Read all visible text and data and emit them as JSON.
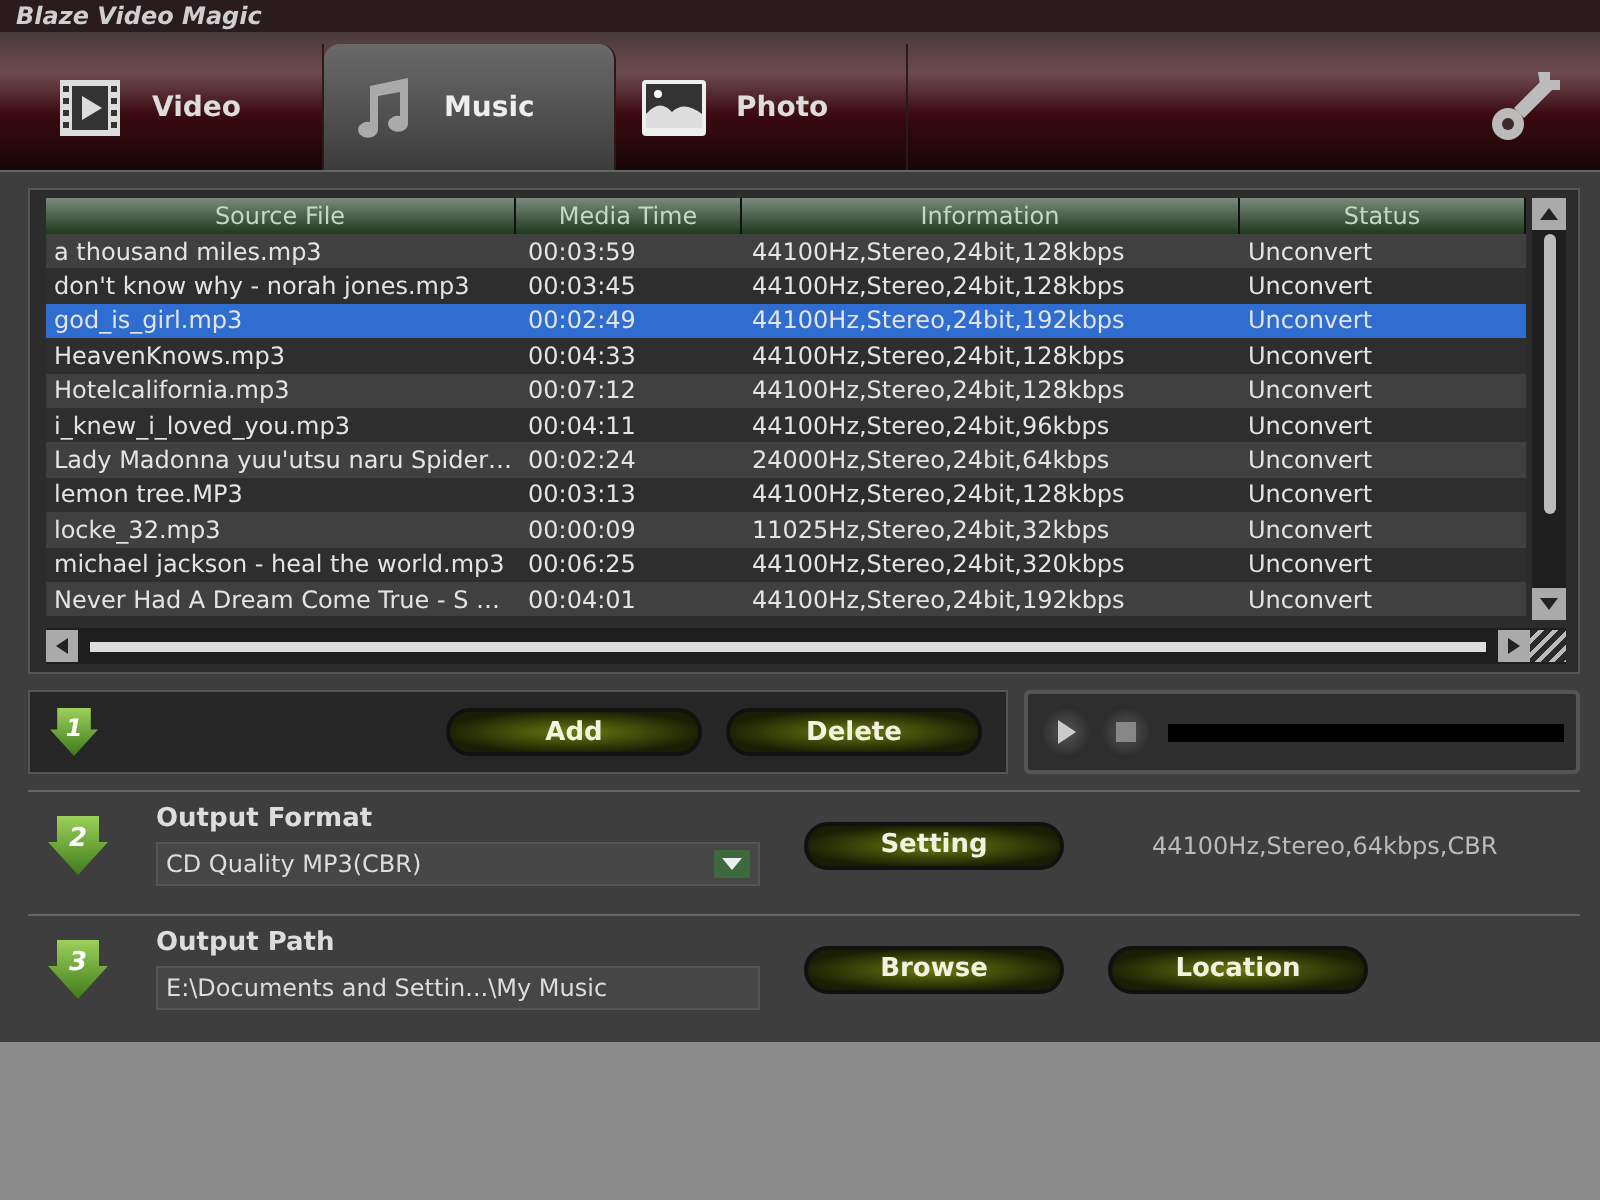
{
  "window": {
    "title": "Blaze Video Magic"
  },
  "player": {
    "level": 0
  },
  "tabs": [
    {
      "label": "Video",
      "kind": "video",
      "selected": false
    },
    {
      "label": "Music",
      "kind": "music",
      "selected": true
    },
    {
      "label": "Photo",
      "kind": "photo",
      "selected": false
    }
  ],
  "table": {
    "columns": [
      "Source File",
      "Media Time",
      "Information",
      "Status"
    ],
    "rows": [
      {
        "cells": [
          "a thousand miles.mp3",
          "00:03:59",
          "44100Hz,Stereo,24bit,128kbps",
          "Unconvert"
        ],
        "selected": false
      },
      {
        "cells": [
          "don't know why - norah jones.mp3",
          "00:03:45",
          "44100Hz,Stereo,24bit,128kbps",
          "Unconvert"
        ],
        "selected": false
      },
      {
        "cells": [
          "god_is_girl.mp3",
          "00:02:49",
          "44100Hz,Stereo,24bit,192kbps",
          "Unconvert"
        ],
        "selected": true
      },
      {
        "cells": [
          "HeavenKnows.mp3",
          "00:04:33",
          "44100Hz,Stereo,24bit,128kbps",
          "Unconvert"
        ],
        "selected": false
      },
      {
        "cells": [
          "Hotelcalifornia.mp3",
          "00:07:12",
          "44100Hz,Stereo,24bit,128kbps",
          "Unconvert"
        ],
        "selected": false
      },
      {
        "cells": [
          "i_knew_i_loved_you.mp3",
          "00:04:11",
          "44100Hz,Stereo,24bit,96kbps",
          "Unconvert"
        ],
        "selected": false
      },
      {
        "cells": [
          "Lady Madonna yuu'utsu naru Spider…",
          "00:02:24",
          "24000Hz,Stereo,24bit,64kbps",
          "Unconvert"
        ],
        "selected": false
      },
      {
        "cells": [
          "lemon tree.MP3",
          "00:03:13",
          "44100Hz,Stereo,24bit,128kbps",
          "Unconvert"
        ],
        "selected": false
      },
      {
        "cells": [
          "locke_32.mp3",
          "00:00:09",
          "11025Hz,Stereo,24bit,32kbps",
          "Unconvert"
        ],
        "selected": false
      },
      {
        "cells": [
          "michael jackson - heal the world.mp3",
          "00:06:25",
          "44100Hz,Stereo,24bit,320kbps",
          "Unconvert"
        ],
        "selected": false
      },
      {
        "cells": [
          "Never Had A Dream Come True - S …",
          "00:04:01",
          "44100Hz,Stereo,24bit,192kbps",
          "Unconvert"
        ],
        "selected": false
      }
    ]
  },
  "step1": {
    "number": "1",
    "buttons": [
      "Add",
      "Delete"
    ]
  },
  "output_format": {
    "number": "2",
    "label": "Output Format",
    "value": "CD Quality MP3(CBR)",
    "button": "Setting",
    "info": "44100Hz,Stereo,64kbps,CBR"
  },
  "output_path": {
    "number": "3",
    "label": "Output Path",
    "value": "E:\\Documents and Settin...\\My Music",
    "buttons": [
      "Browse",
      "Location"
    ]
  }
}
